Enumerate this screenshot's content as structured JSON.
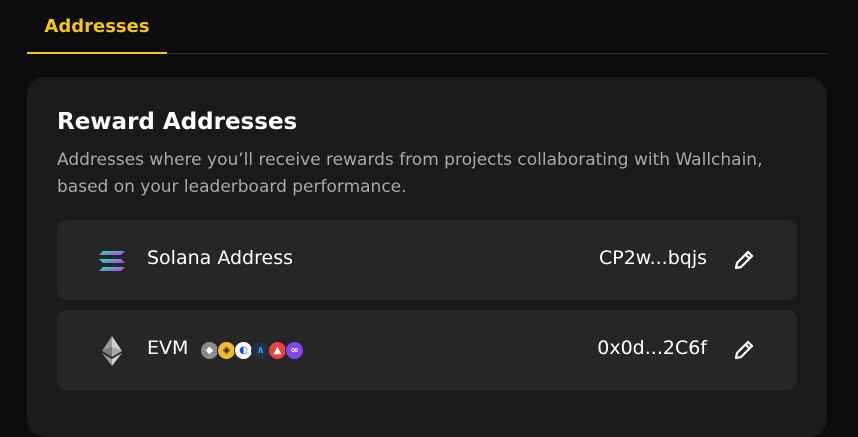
{
  "tabs": [
    {
      "label": "Addresses",
      "active": true
    }
  ],
  "card": {
    "title": "Reward Addresses",
    "description": "Addresses where you’ll receive rewards from projects collaborating with Wallchain, based on your leaderboard performance."
  },
  "rows": [
    {
      "label": "Solana Address",
      "value": "CP2w...bqjs",
      "icon": "solana-icon"
    },
    {
      "label": "EVM",
      "value": "0x0d...2C6f",
      "icon": "ethereum-icon",
      "networks": [
        "ethereum-icon",
        "bnb-icon",
        "base-icon",
        "arbitrum-icon",
        "avalanche-icon",
        "polygon-icon"
      ]
    }
  ],
  "colors": {
    "accent": "#f5c518",
    "card": "#1a1a1a",
    "row": "#262626",
    "muted": "#a9a9a9"
  }
}
